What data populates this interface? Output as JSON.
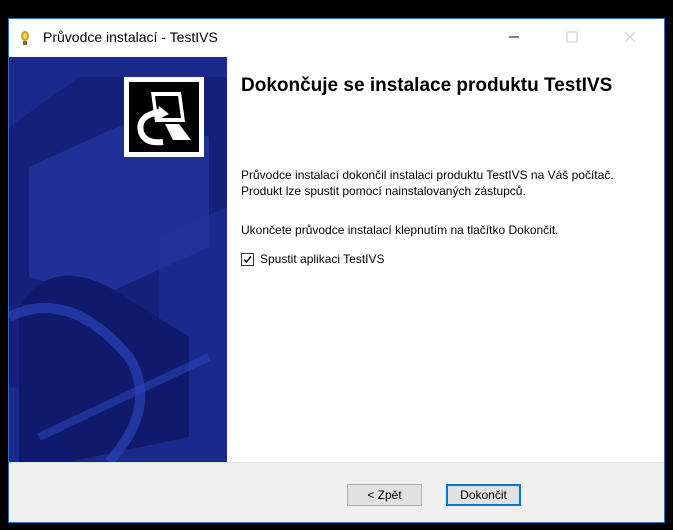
{
  "window": {
    "title": "Průvodce instalací - TestIVS",
    "accent_color": "#2b6cc4",
    "controls": {
      "minimize_icon": "minimize-icon",
      "maximize_icon": "maximize-icon",
      "close_icon": "close-icon"
    }
  },
  "side_panel": {
    "background_color": "#1a2a8c",
    "logo_icon": "installer-computer-icon"
  },
  "content": {
    "heading": "Dokončuje se instalace produktu TestIVS",
    "paragraph1": "Průvodce instalací dokončil instalaci produktu TestIVS na Váš počítač. Produkt lze spustit pomocí nainstalovaných zástupců.",
    "paragraph2": "Ukončete průvodce instalací klepnutím na tlačítko Dokončit.",
    "launch_checkbox": {
      "label": "Spustit aplikaci TestIVS",
      "checked": true
    }
  },
  "footer": {
    "back_label": "< Zpět",
    "finish_label": "Dokončit"
  }
}
